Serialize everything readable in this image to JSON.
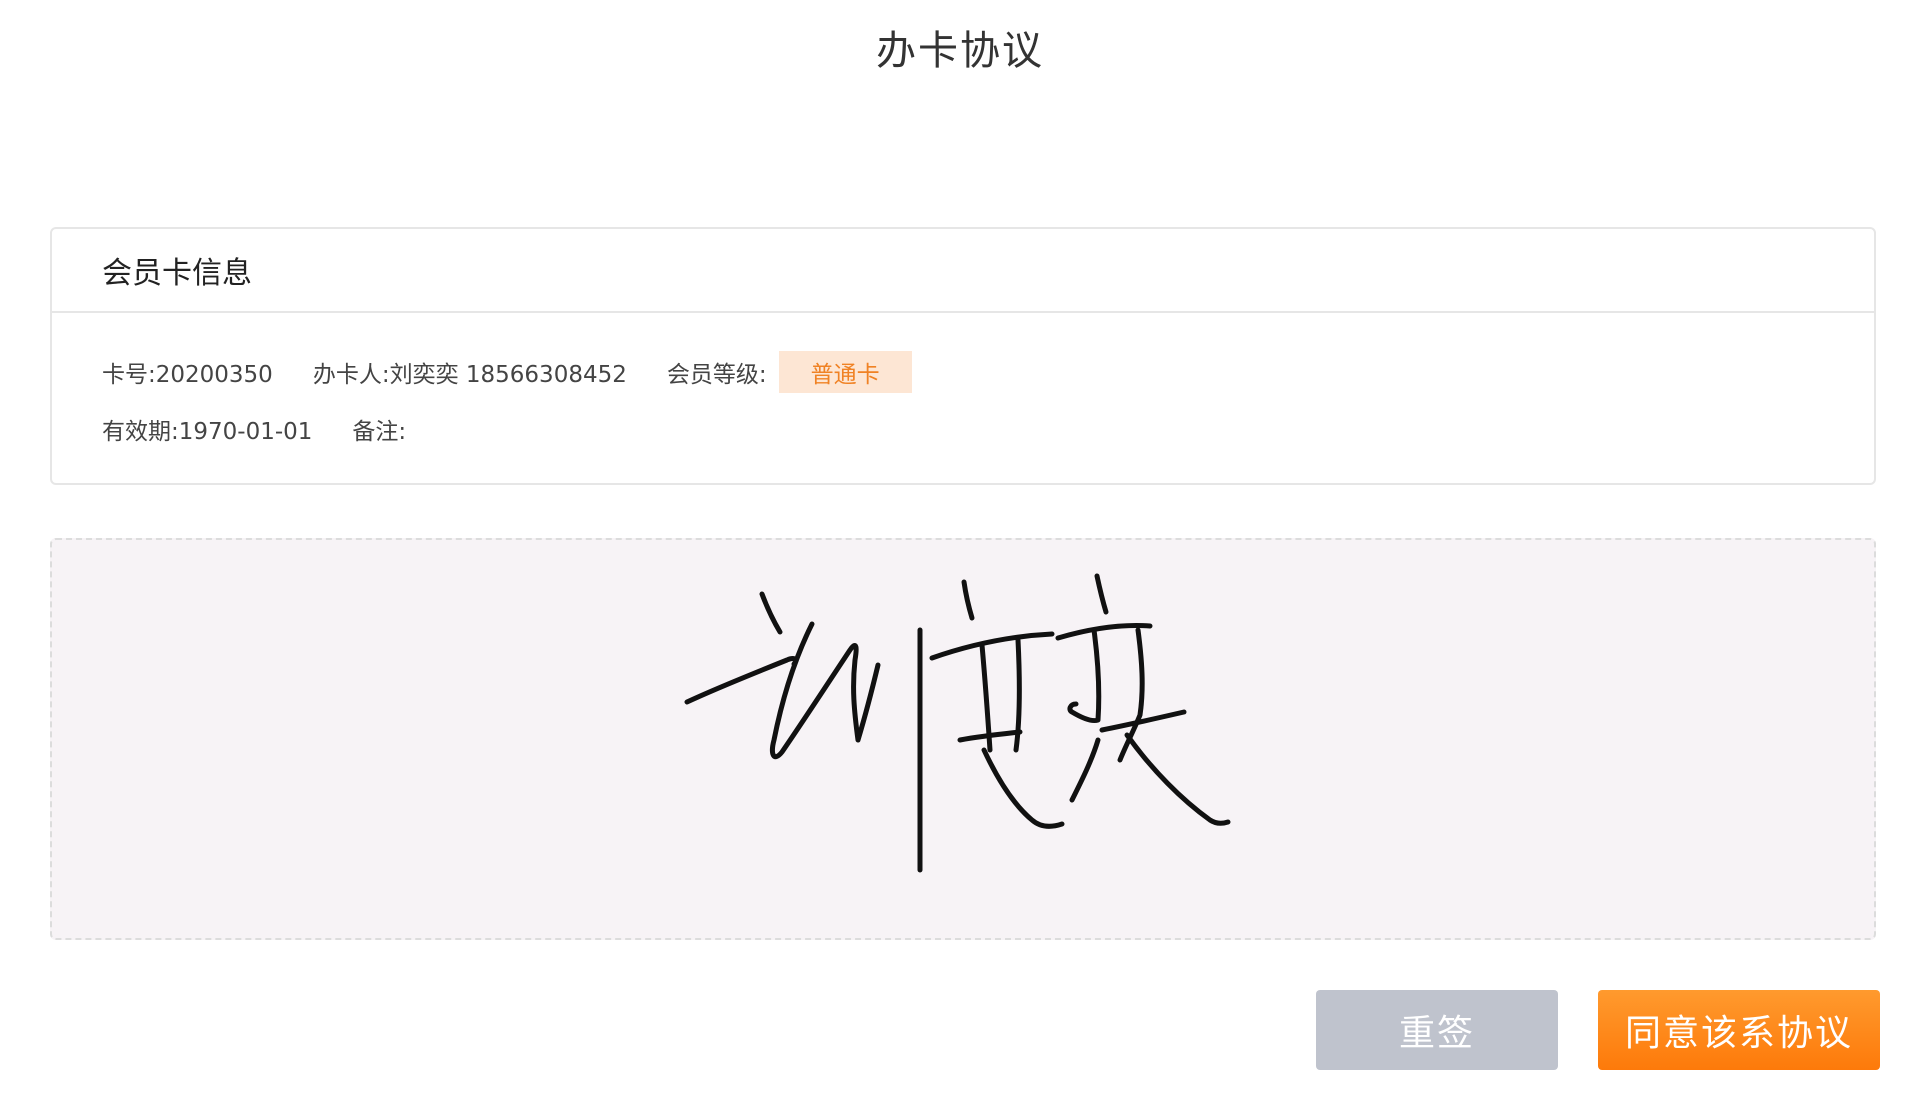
{
  "page": {
    "title": "办卡协议"
  },
  "card": {
    "header": "会员卡信息",
    "card_no": "卡号:20200350",
    "holder": "办卡人:刘奕奕 18566308452",
    "level_label": "会员等级:",
    "level_value": "普通卡",
    "valid_until": "有效期:1970-01-01",
    "remark": "备注:"
  },
  "signature": {
    "content": "刘奕奕",
    "ink_color": "#111111",
    "pad_color": "#f7f3f6"
  },
  "actions": {
    "resign_label": "重签",
    "agree_label": "同意该系协议"
  },
  "colors": {
    "accent": "#fd7a0a",
    "badge_bg": "#fde6d4",
    "badge_text": "#f08224",
    "disabled_button": "#bfc3cd"
  }
}
